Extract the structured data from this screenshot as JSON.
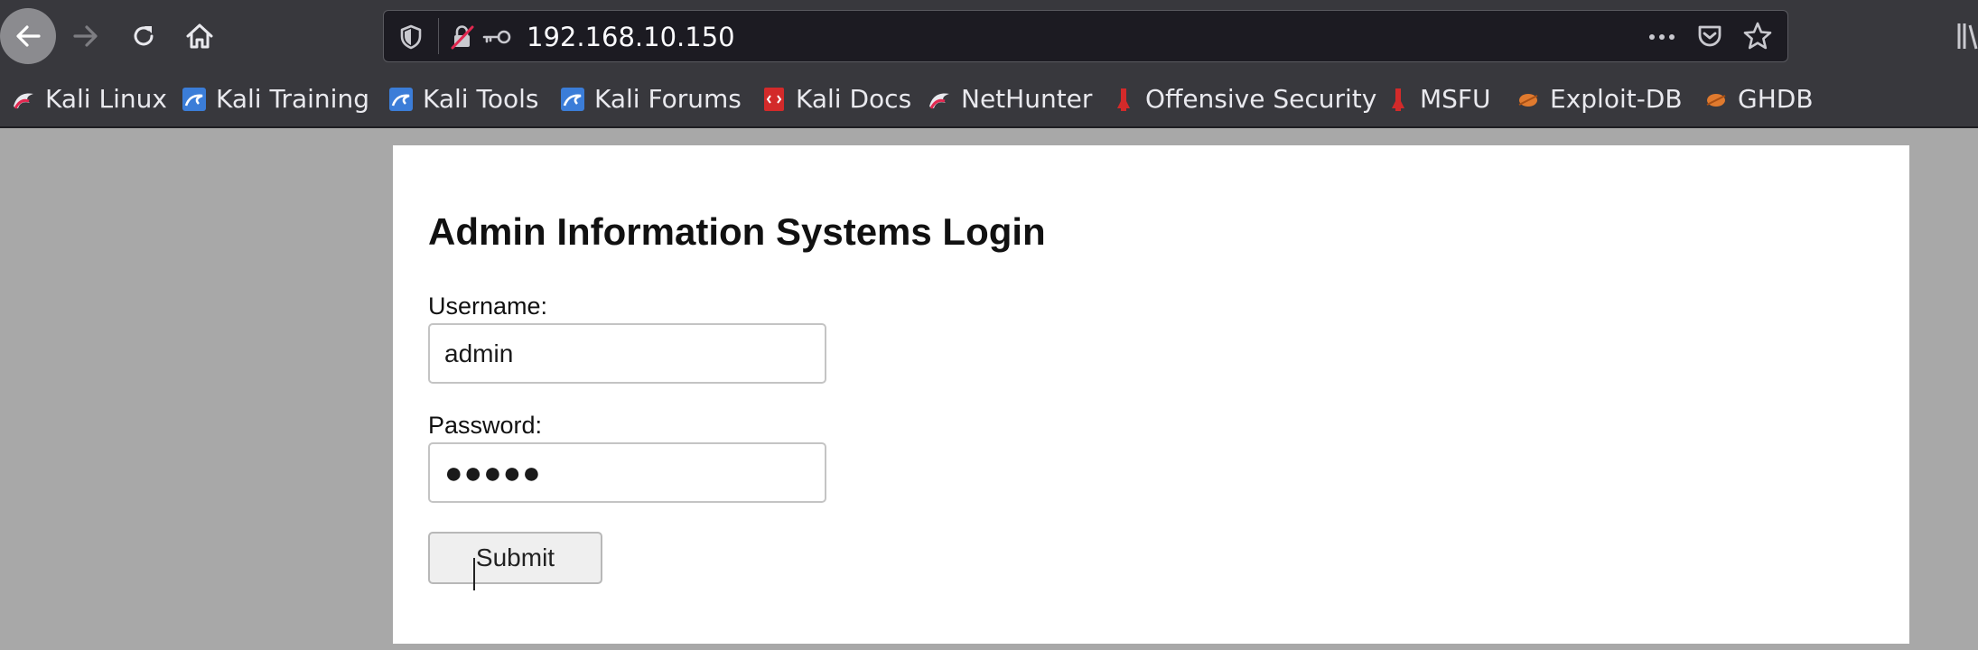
{
  "browser": {
    "url": "192.168.10.150",
    "nav_icons": [
      "back-arrow-icon",
      "forward-arrow-icon",
      "reload-icon",
      "home-icon"
    ],
    "url_icons": [
      "shield-icon",
      "insecure-lock-icon",
      "key-icon",
      "more-actions-icon",
      "pocket-icon",
      "bookmark-star-icon"
    ],
    "colors": {
      "toolbar": "#38383d",
      "url_background": "#1c1b22",
      "url_text": "#fbfbfe"
    }
  },
  "bookmarks": [
    {
      "label": "Kali Linux",
      "icon": "kali-dragon-icon"
    },
    {
      "label": "Kali Training",
      "icon": "kali-training-icon"
    },
    {
      "label": "Kali Tools",
      "icon": "kali-tools-icon"
    },
    {
      "label": "Kali Forums",
      "icon": "kali-forums-icon"
    },
    {
      "label": "Kali Docs",
      "icon": "kali-docs-icon"
    },
    {
      "label": "NetHunter",
      "icon": "nethunter-icon"
    },
    {
      "label": "Offensive Security",
      "icon": "offsec-icon"
    },
    {
      "label": "MSFU",
      "icon": "msfu-icon"
    },
    {
      "label": "Exploit-DB",
      "icon": "exploit-db-icon"
    },
    {
      "label": "GHDB",
      "icon": "ghdb-icon"
    }
  ],
  "page": {
    "title": "Admin Information Systems Login",
    "username_label": "Username:",
    "username_value": "admin",
    "password_label": "Password:",
    "password_masked": "●●●●●",
    "submit_label": "Submit",
    "colors": {
      "background": "#a8a8a8",
      "panel": "#ffffff"
    }
  }
}
